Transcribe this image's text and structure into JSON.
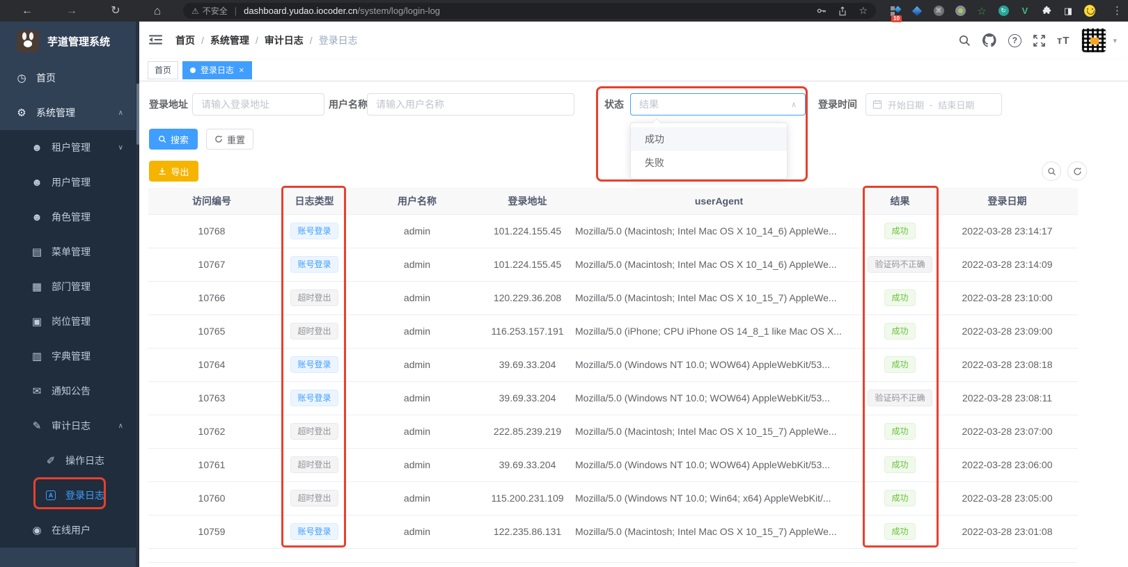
{
  "browser": {
    "security_label": "不安全",
    "url_domain": "dashboard.yudao.iocoder.cn",
    "url_path": "/system/log/login-log",
    "extension_badge": "10"
  },
  "sidebar": {
    "logo_title": "芋道管理系统",
    "items": [
      {
        "name": "sidebar-item-home",
        "label": "首页",
        "glyph": "◷",
        "cls": "lvl0",
        "iconCls": "",
        "chevron": ""
      },
      {
        "name": "sidebar-item-system-management",
        "label": "系统管理",
        "glyph": "⚙",
        "cls": "lvl0",
        "iconCls": "",
        "chevron": "∧"
      },
      {
        "name": "sidebar-item-tenant-management",
        "label": "租户管理",
        "glyph": "☻",
        "cls": "lvl1",
        "iconCls": "",
        "chevron": "∨"
      },
      {
        "name": "sidebar-item-user-management",
        "label": "用户管理",
        "glyph": "☻",
        "cls": "lvl1",
        "iconCls": "",
        "chevron": ""
      },
      {
        "name": "sidebar-item-role-management",
        "label": "角色管理",
        "glyph": "☻",
        "cls": "lvl1",
        "iconCls": "",
        "chevron": ""
      },
      {
        "name": "sidebar-item-menu-management",
        "label": "菜单管理",
        "glyph": "▤",
        "cls": "lvl1",
        "iconCls": "",
        "chevron": ""
      },
      {
        "name": "sidebar-item-dept-management",
        "label": "部门管理",
        "glyph": "▦",
        "cls": "lvl1",
        "iconCls": "",
        "chevron": ""
      },
      {
        "name": "sidebar-item-post-management",
        "label": "岗位管理",
        "glyph": "▣",
        "cls": "lvl1",
        "iconCls": "",
        "chevron": ""
      },
      {
        "name": "sidebar-item-dict-management",
        "label": "字典管理",
        "glyph": "▥",
        "cls": "lvl1",
        "iconCls": "",
        "chevron": ""
      },
      {
        "name": "sidebar-item-notice",
        "label": "通知公告",
        "glyph": "✉",
        "cls": "lvl1",
        "iconCls": "",
        "chevron": ""
      },
      {
        "name": "sidebar-item-audit-log",
        "label": "审计日志",
        "glyph": "✎",
        "cls": "lvl1",
        "iconCls": "",
        "chevron": "∧"
      },
      {
        "name": "sidebar-item-operation-log",
        "label": "操作日志",
        "glyph": "✐",
        "cls": "lvl2",
        "iconCls": "",
        "chevron": ""
      },
      {
        "name": "sidebar-item-login-log",
        "label": "登录日志",
        "glyph": "A",
        "cls": "lvl2 active",
        "iconCls": "icon-box",
        "chevron": ""
      },
      {
        "name": "sidebar-item-online-users",
        "label": "在线用户",
        "glyph": "◉",
        "cls": "lvl1",
        "iconCls": "",
        "chevron": ""
      }
    ]
  },
  "header": {
    "breadcrumb": [
      {
        "label": "首页",
        "sep": "",
        "cls": ""
      },
      {
        "label": "系统管理",
        "sep": "/",
        "cls": ""
      },
      {
        "label": "审计日志",
        "sep": "/",
        "cls": ""
      },
      {
        "label": "登录日志",
        "sep": "/",
        "cls": "current"
      }
    ]
  },
  "tabs": {
    "items": [
      {
        "name": "tab-home",
        "label": "首页",
        "cls": "",
        "close": ""
      },
      {
        "name": "tab-login-log",
        "label": "登录日志",
        "cls": "active",
        "close": "×"
      }
    ]
  },
  "form": {
    "login_address_label": "登录地址",
    "login_address_placeholder": "请输入登录地址",
    "username_label": "用户名称",
    "username_placeholder": "请输入用户名称",
    "status_label": "状态",
    "status_placeholder": "结果",
    "status_options": [
      {
        "name": "status-option-success",
        "label": "成功",
        "cls": "hover"
      },
      {
        "name": "status-option-failure",
        "label": "失败",
        "cls": ""
      }
    ],
    "login_time_label": "登录时间",
    "date_start_placeholder": "开始日期",
    "date_separator": "-",
    "date_end_placeholder": "结束日期"
  },
  "toolbar": {
    "search_label": "搜索",
    "reset_label": "重置",
    "export_label": "导出"
  },
  "table": {
    "headers": [
      {
        "label": "访问编号",
        "cls": "c1"
      },
      {
        "label": "日志类型",
        "cls": "c2"
      },
      {
        "label": "用户名称",
        "cls": "c3"
      },
      {
        "label": "登录地址",
        "cls": "c4"
      },
      {
        "label": "userAgent",
        "cls": "c5"
      },
      {
        "label": "结果",
        "cls": "c6"
      },
      {
        "label": "登录日期",
        "cls": "c7"
      }
    ],
    "rows": [
      {
        "id": "10768",
        "type": "账号登录",
        "type_cls": "tag-blue",
        "user": "admin",
        "ip": "101.224.155.45",
        "ua": "Mozilla/5.0 (Macintosh; Intel Mac OS X 10_14_6) AppleWe...",
        "result": "成功",
        "result_cls": "tag-green",
        "date": "2022-03-28 23:14:17"
      },
      {
        "id": "10767",
        "type": "账号登录",
        "type_cls": "tag-blue",
        "user": "admin",
        "ip": "101.224.155.45",
        "ua": "Mozilla/5.0 (Macintosh; Intel Mac OS X 10_14_6) AppleWe...",
        "result": "验证码不正确",
        "result_cls": "tag-gray",
        "date": "2022-03-28 23:14:09"
      },
      {
        "id": "10766",
        "type": "超时登出",
        "type_cls": "tag-gray",
        "user": "admin",
        "ip": "120.229.36.208",
        "ua": "Mozilla/5.0 (Macintosh; Intel Mac OS X 10_15_7) AppleWe...",
        "result": "成功",
        "result_cls": "tag-green",
        "date": "2022-03-28 23:10:00"
      },
      {
        "id": "10765",
        "type": "超时登出",
        "type_cls": "tag-gray",
        "user": "admin",
        "ip": "116.253.157.191",
        "ua": "Mozilla/5.0 (iPhone; CPU iPhone OS 14_8_1 like Mac OS X...",
        "result": "成功",
        "result_cls": "tag-green",
        "date": "2022-03-28 23:09:00"
      },
      {
        "id": "10764",
        "type": "账号登录",
        "type_cls": "tag-blue",
        "user": "admin",
        "ip": "39.69.33.204",
        "ua": "Mozilla/5.0 (Windows NT 10.0; WOW64) AppleWebKit/53...",
        "result": "成功",
        "result_cls": "tag-green",
        "date": "2022-03-28 23:08:18"
      },
      {
        "id": "10763",
        "type": "账号登录",
        "type_cls": "tag-blue",
        "user": "admin",
        "ip": "39.69.33.204",
        "ua": "Mozilla/5.0 (Windows NT 10.0; WOW64) AppleWebKit/53...",
        "result": "验证码不正确",
        "result_cls": "tag-gray",
        "date": "2022-03-28 23:08:11"
      },
      {
        "id": "10762",
        "type": "超时登出",
        "type_cls": "tag-gray",
        "user": "admin",
        "ip": "222.85.239.219",
        "ua": "Mozilla/5.0 (Macintosh; Intel Mac OS X 10_15_7) AppleWe...",
        "result": "成功",
        "result_cls": "tag-green",
        "date": "2022-03-28 23:07:00"
      },
      {
        "id": "10761",
        "type": "超时登出",
        "type_cls": "tag-gray",
        "user": "admin",
        "ip": "39.69.33.204",
        "ua": "Mozilla/5.0 (Windows NT 10.0; WOW64) AppleWebKit/53...",
        "result": "成功",
        "result_cls": "tag-green",
        "date": "2022-03-28 23:06:00"
      },
      {
        "id": "10760",
        "type": "超时登出",
        "type_cls": "tag-gray",
        "user": "admin",
        "ip": "115.200.231.109",
        "ua": "Mozilla/5.0 (Windows NT 10.0; Win64; x64) AppleWebKit/...",
        "result": "成功",
        "result_cls": "tag-green",
        "date": "2022-03-28 23:05:00"
      },
      {
        "id": "10759",
        "type": "账号登录",
        "type_cls": "tag-blue",
        "user": "admin",
        "ip": "122.235.86.131",
        "ua": "Mozilla/5.0 (Macintosh; Intel Mac OS X 10_15_7) AppleWe...",
        "result": "成功",
        "result_cls": "tag-green",
        "date": "2022-03-28 23:01:08"
      }
    ]
  },
  "icons": {
    "browser-back-icon": "←",
    "browser-forward-icon": "→",
    "browser-reload-icon": "↻",
    "browser-home-icon": "⌂",
    "warning-icon": "⚠",
    "bookmark-star-icon": "☆",
    "browser-menu-icon": "⋮",
    "side-panel-icon": "◨",
    "chevron-up-icon": "∧",
    "chevron-down-icon": "∨",
    "caret-down-icon": "▾",
    "font-size-icon": "тT"
  },
  "colors": {
    "primary": "#409eff",
    "warning_button": "#f5b400",
    "annotation_red": "#e8402d",
    "success_tag": "#67c23a",
    "info_tag": "#909399",
    "sidebar_bg": "#304156",
    "submenu_bg": "#1f2d3d"
  }
}
